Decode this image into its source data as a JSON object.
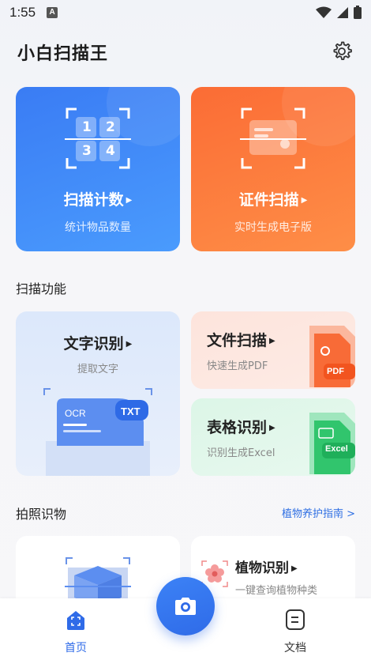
{
  "status_bar": {
    "time": "1:55",
    "notification_badge": "A"
  },
  "header": {
    "title": "小白扫描王"
  },
  "top_cards": {
    "count": {
      "title": "扫描计数",
      "subtitle": "统计物品数量",
      "digits": [
        "1",
        "2",
        "3",
        "4"
      ]
    },
    "id": {
      "title": "证件扫描",
      "subtitle": "实时生成电子版"
    }
  },
  "scan_section": {
    "label": "扫描功能",
    "ocr": {
      "title": "文字识别",
      "subtitle": "提取文字",
      "badge_ocr": "OCR",
      "badge_txt": "TXT"
    },
    "file": {
      "title": "文件扫描",
      "subtitle": "快速生成PDF",
      "badge": "PDF"
    },
    "table": {
      "title": "表格识别",
      "subtitle": "识别生成Excel",
      "badge": "Excel"
    }
  },
  "photo_section": {
    "label": "拍照识物",
    "guide_link": "植物养护指南 >",
    "plant": {
      "title": "植物识别",
      "subtitle": "一键查询植物种类"
    }
  },
  "bottom_nav": {
    "home_label": "首页",
    "docs_label": "文档"
  },
  "colors": {
    "accent_blue": "#2f6be8",
    "accent_orange": "#fb6c35",
    "link_blue": "#2f6fe3"
  }
}
